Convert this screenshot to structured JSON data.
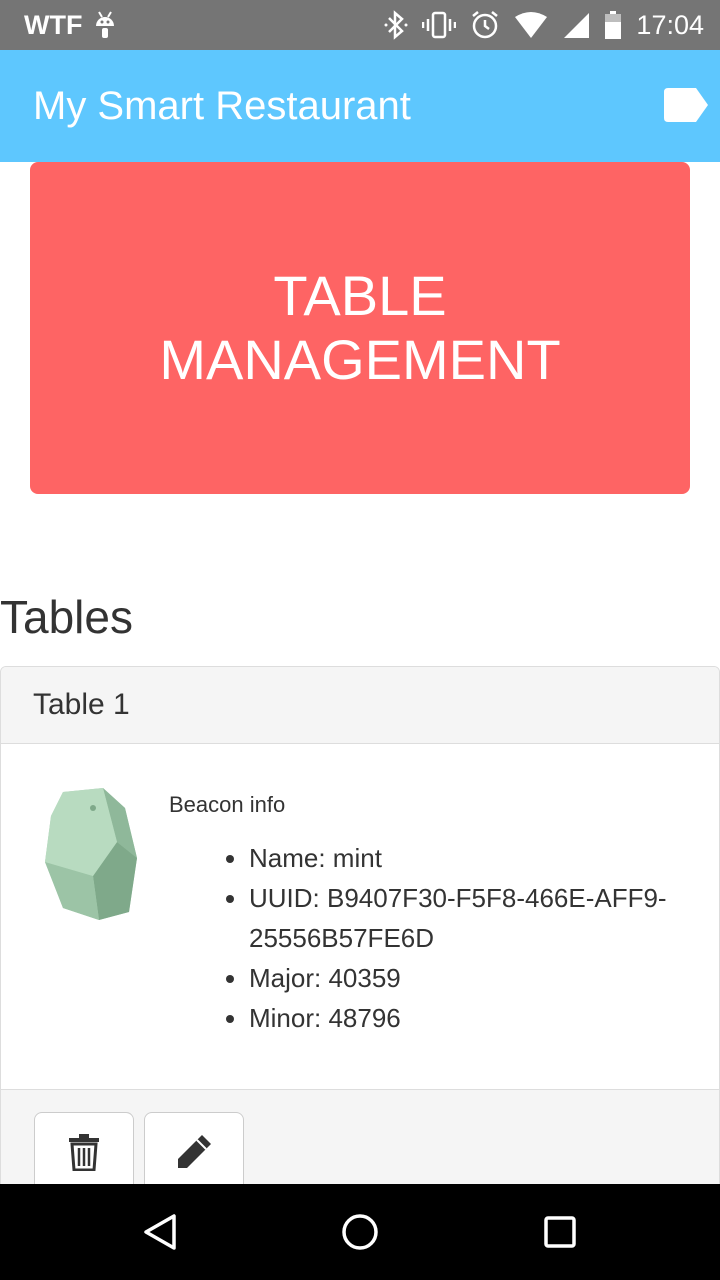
{
  "status_bar": {
    "carrier": "WTF",
    "time": "17:04",
    "icons": [
      "android-icon",
      "bluetooth-icon",
      "vibrate-icon",
      "alarm-icon",
      "wifi-icon",
      "signal-icon",
      "battery-icon"
    ]
  },
  "app_bar": {
    "title": "My Smart Restaurant",
    "action_icon": "tag-icon"
  },
  "hero": {
    "label": "TABLE MANAGEMENT",
    "background_color": "#fe6464"
  },
  "section": {
    "title": "Tables"
  },
  "tables": [
    {
      "name": "Table 1",
      "beacon_label": "Beacon info",
      "beacon_details": [
        "Name: mint",
        "UUID: B9407F30-F5F8-466E-AFF9-25556B57FE6D",
        "Major: 40359",
        "Minor: 48796"
      ],
      "actions": [
        "trash-icon",
        "pencil-icon"
      ]
    }
  ],
  "nav_bar": {
    "buttons": [
      "back-icon",
      "home-icon",
      "recents-icon"
    ]
  },
  "colors": {
    "app_bar": "#5ec7fe",
    "status_bar": "#757575",
    "hero": "#fe6464"
  }
}
